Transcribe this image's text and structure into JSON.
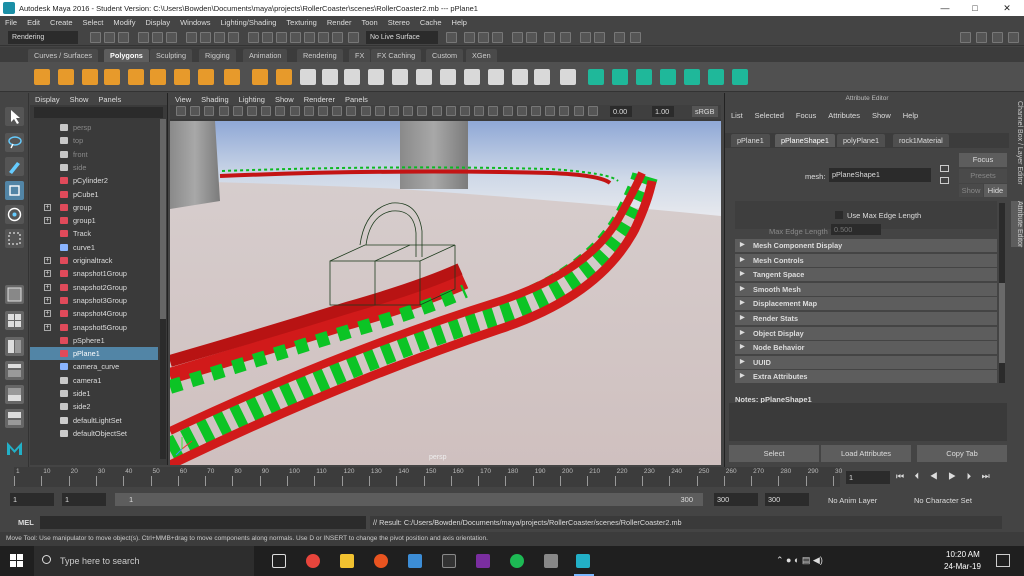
{
  "window": {
    "title": "Autodesk Maya 2016 - Student Version: C:\\Users\\Bowden\\Documents\\maya\\projects\\RollerCoaster\\scenes\\RollerCoaster2.mb  ---  pPlane1",
    "minimize": "—",
    "maximize": "□",
    "close": "✕"
  },
  "menubar": [
    "File",
    "Edit",
    "Create",
    "Select",
    "Modify",
    "Display",
    "Windows",
    "Lighting/Shading",
    "Texturing",
    "Render",
    "Toon",
    "Stereo",
    "Cache",
    "Help"
  ],
  "statusline": {
    "menuset": "Rendering",
    "live_surface": "No Live Surface"
  },
  "shelf": {
    "tabs": [
      "Curves / Surfaces",
      "Polygons",
      "Sculpting",
      "Rigging",
      "Animation",
      "Rendering",
      "FX",
      "FX Caching",
      "Custom",
      "XGen"
    ],
    "active_tab": "Polygons"
  },
  "outliner": {
    "menu": [
      "Display",
      "Show",
      "Panels"
    ],
    "items": [
      {
        "label": "persp",
        "dim": true,
        "expand": "",
        "icon": "camera-icon"
      },
      {
        "label": "top",
        "dim": true,
        "expand": "",
        "icon": "camera-icon"
      },
      {
        "label": "front",
        "dim": true,
        "expand": "",
        "icon": "camera-icon"
      },
      {
        "label": "side",
        "dim": true,
        "expand": "",
        "icon": "camera-icon"
      },
      {
        "label": "pCylinder2",
        "dim": false,
        "expand": "",
        "icon": "mesh-icon"
      },
      {
        "label": "pCube1",
        "dim": false,
        "expand": "",
        "icon": "mesh-icon"
      },
      {
        "label": "group",
        "dim": false,
        "expand": "+",
        "icon": "group-icon"
      },
      {
        "label": "group1",
        "dim": false,
        "expand": "+",
        "icon": "group-icon"
      },
      {
        "label": "Track",
        "dim": false,
        "expand": "",
        "icon": "group-icon"
      },
      {
        "label": "curve1",
        "dim": false,
        "expand": "",
        "icon": "curve-icon"
      },
      {
        "label": "originaltrack",
        "dim": false,
        "expand": "+",
        "icon": "group-icon"
      },
      {
        "label": "snapshot1Group",
        "dim": false,
        "expand": "+",
        "icon": "group-icon"
      },
      {
        "label": "snapshot2Group",
        "dim": false,
        "expand": "+",
        "icon": "group-icon"
      },
      {
        "label": "snapshot3Group",
        "dim": false,
        "expand": "+",
        "icon": "group-icon"
      },
      {
        "label": "snapshot4Group",
        "dim": false,
        "expand": "+",
        "icon": "group-icon"
      },
      {
        "label": "snapshot5Group",
        "dim": false,
        "expand": "+",
        "icon": "group-icon"
      },
      {
        "label": "pSphere1",
        "dim": false,
        "expand": "",
        "icon": "mesh-icon"
      },
      {
        "label": "pPlane1",
        "dim": false,
        "expand": "",
        "icon": "mesh-icon",
        "selected": true
      },
      {
        "label": "camera_curve",
        "dim": false,
        "expand": "",
        "icon": "curve-icon"
      },
      {
        "label": "camera1",
        "dim": false,
        "expand": "",
        "icon": "camera-icon"
      },
      {
        "label": "side1",
        "dim": false,
        "expand": "",
        "icon": "camera-icon"
      },
      {
        "label": "side2",
        "dim": false,
        "expand": "",
        "icon": "camera-icon"
      },
      {
        "label": "defaultLightSet",
        "dim": false,
        "expand": "",
        "icon": "set-icon"
      },
      {
        "label": "defaultObjectSet",
        "dim": false,
        "expand": "",
        "icon": "set-icon"
      }
    ]
  },
  "viewport": {
    "menu": [
      "View",
      "Shading",
      "Lighting",
      "Show",
      "Renderer",
      "Panels"
    ],
    "field_a": "0.00",
    "field_b": "1.00",
    "colorspace": "sRGB",
    "camera_label": "persp"
  },
  "attribute_editor": {
    "header": "Attribute Editor",
    "menu": [
      "List",
      "Selected",
      "Focus",
      "Attributes",
      "Show",
      "Help"
    ],
    "tabs": [
      "pPlane1",
      "pPlaneShape1",
      "polyPlane1",
      "rock1Material"
    ],
    "active_tab": "pPlaneShape1",
    "mesh_label": "mesh:",
    "mesh_value": "pPlaneShape1",
    "focus_btn": "Focus",
    "presets_btn": "Presets",
    "show_btn": "Show",
    "hide_btn": "Hide",
    "use_max_edge": "Use Max Edge Length",
    "max_edge_label": "Max Edge Length",
    "max_edge_value": "0.500",
    "sections": [
      "Mesh Component Display",
      "Mesh Controls",
      "Tangent Space",
      "Smooth Mesh",
      "Displacement Map",
      "Render Stats",
      "Object Display",
      "Node Behavior",
      "UUID",
      "Extra Attributes"
    ],
    "notes_label": "Notes:  pPlaneShape1",
    "buttons": [
      "Select",
      "Load Attributes",
      "Copy Tab"
    ]
  },
  "side_tabs": [
    "Channel Box / Layer Editor",
    "Attribute Editor"
  ],
  "timeline": {
    "ticks": [
      "1",
      "10",
      "20",
      "30",
      "40",
      "50",
      "60",
      "70",
      "80",
      "90",
      "100",
      "110",
      "120",
      "130",
      "140",
      "150",
      "160",
      "170",
      "180",
      "190",
      "200",
      "210",
      "220",
      "230",
      "240",
      "250",
      "260",
      "270",
      "280",
      "290",
      "30"
    ],
    "current_frame": "1",
    "range_start": "1",
    "range_start2": "1",
    "slider_start": "1",
    "slider_end": "300",
    "range_end": "300",
    "range_end2": "300",
    "anim_layer": "No Anim Layer",
    "character_set": "No Character Set"
  },
  "cmdline": {
    "lang": "MEL",
    "result": "// Result: C:/Users/Bowden/Documents/maya/projects/RollerCoaster/scenes/RollerCoaster2.mb"
  },
  "helpline": "Move Tool: Use manipulator to move object(s). Ctrl+MMB+drag to move components along normals. Use D or INSERT to change the pivot position and axis orientation.",
  "taskbar": {
    "search": "Type here to search",
    "time": "10:20 AM",
    "date": "24-Mar-19"
  },
  "colors": {
    "track_red": "#d11a1a",
    "track_green": "#10d12a",
    "selection": "#5285a6"
  }
}
